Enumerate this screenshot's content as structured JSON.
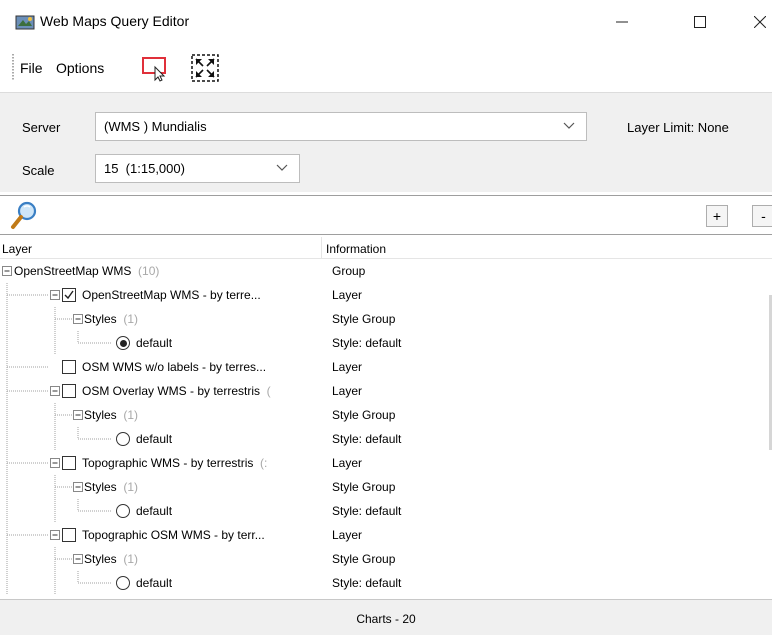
{
  "window": {
    "title": "Web Maps Query Editor"
  },
  "menu": {
    "file": "File",
    "options": "Options"
  },
  "toolbar": {
    "icons": [
      "select-rect-icon",
      "expand-icon"
    ]
  },
  "server": {
    "label": "Server",
    "value": "(WMS ) Mundialis"
  },
  "scale": {
    "label": "Scale",
    "value": "15  (1:15,000)"
  },
  "layer_limit": "Layer Limit: None",
  "search": {
    "add_label": "+",
    "remove_label": "-"
  },
  "tree": {
    "headers": {
      "layer": "Layer",
      "information": "Information"
    },
    "rows": [
      {
        "name": "OpenStreetMap WMS",
        "count": "(10)",
        "info": "Group"
      },
      {
        "name": "OpenStreetMap WMS - by terre...",
        "count": "",
        "info": "Layer",
        "checked": true
      },
      {
        "name": "Styles",
        "count": "(1)",
        "info": "Style Group"
      },
      {
        "name": "default",
        "count": "",
        "info": "Style: default",
        "selected": true
      },
      {
        "name": "OSM WMS w/o labels - by terres...",
        "count": "",
        "info": "Layer",
        "checked": false
      },
      {
        "name": "OSM Overlay WMS - by terrestris",
        "count": "(",
        "info": "Layer",
        "checked": false
      },
      {
        "name": "Styles",
        "count": "(1)",
        "info": "Style Group"
      },
      {
        "name": "default",
        "count": "",
        "info": "Style: default",
        "selected": false
      },
      {
        "name": "Topographic WMS - by terrestris",
        "count": "(:",
        "info": "Layer",
        "checked": false
      },
      {
        "name": "Styles",
        "count": "(1)",
        "info": "Style Group"
      },
      {
        "name": "default",
        "count": "",
        "info": "Style: default",
        "selected": false
      },
      {
        "name": "Topographic OSM WMS - by terr...",
        "count": "",
        "info": "Layer",
        "checked": false
      },
      {
        "name": "Styles",
        "count": "(1)",
        "info": "Style Group"
      },
      {
        "name": "default",
        "count": "",
        "info": "Style: default",
        "selected": false
      }
    ]
  },
  "status": "Charts - 20",
  "colors": {
    "panel_bg": "#f0f0f0",
    "accent_red": "#e0303a",
    "search_blue": "#3a7fc4"
  }
}
